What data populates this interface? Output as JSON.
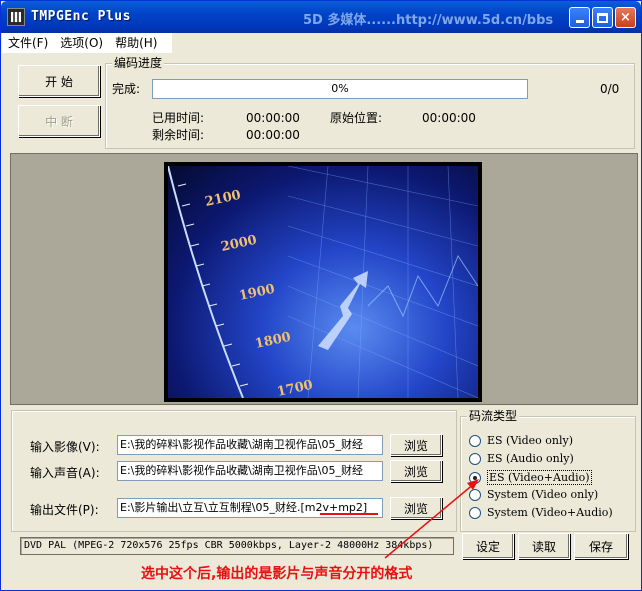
{
  "window": {
    "title": "TMPGEnc Plus",
    "watermark": "5D 多媒体......http://www.5d.cn/bbs",
    "min_button": "minimize",
    "max_button": "maximize",
    "close_button": "×"
  },
  "menu": {
    "items": [
      {
        "label": "文件(F)"
      },
      {
        "label": "选项(O)"
      },
      {
        "label": "帮助(H)"
      }
    ]
  },
  "controls": {
    "start_label": "开 始",
    "stop_label": "中 断"
  },
  "progress": {
    "group_title": "编码进度",
    "complete_label": "完成:",
    "percent_text": "0%",
    "percent_value": 0,
    "frames": "0/0",
    "elapsed_label": "已用时间:",
    "elapsed_value": "00:00:00",
    "remaining_label": "剩余时间:",
    "remaining_value": "00:00:00",
    "source_pos_label": "原始位置:",
    "source_pos_value": "00:00:00"
  },
  "preview": {
    "ticks": [
      "2100",
      "2000",
      "1900",
      "1800",
      "1700"
    ]
  },
  "io": {
    "video_label": "输入影像(V):",
    "video_path": "E:\\我的碎料\\影视作品收藏\\湖南卫视作品\\05_财经",
    "audio_label": "输入声音(A):",
    "audio_path": "E:\\我的碎料\\影视作品收藏\\湖南卫视作品\\05_财经",
    "output_label": "输出文件(P):",
    "output_path": "E:\\影片输出\\立互\\立互制程\\05_财经.",
    "output_ext": "[m2v+mp2]",
    "browse_label": "浏览"
  },
  "stream_type": {
    "title": "码流类型",
    "options": [
      {
        "label": "ES (Video only)",
        "selected": false
      },
      {
        "label": "ES (Audio only)",
        "selected": false
      },
      {
        "label": "ES (Video+Audio)",
        "selected": true
      },
      {
        "label": "System (Video only)",
        "selected": false
      },
      {
        "label": "System (Video+Audio)",
        "selected": false
      }
    ]
  },
  "status": {
    "text": "DVD PAL (MPEG-2 720x576 25fps CBR 5000kbps,  Layer-2 48000Hz 384kbps)"
  },
  "buttons": {
    "setting": "设定",
    "load": "读取",
    "save": "保存"
  },
  "annotation": {
    "text": "选中这个后,输出的是影片与声音分开的格式",
    "color": "#e81010"
  }
}
